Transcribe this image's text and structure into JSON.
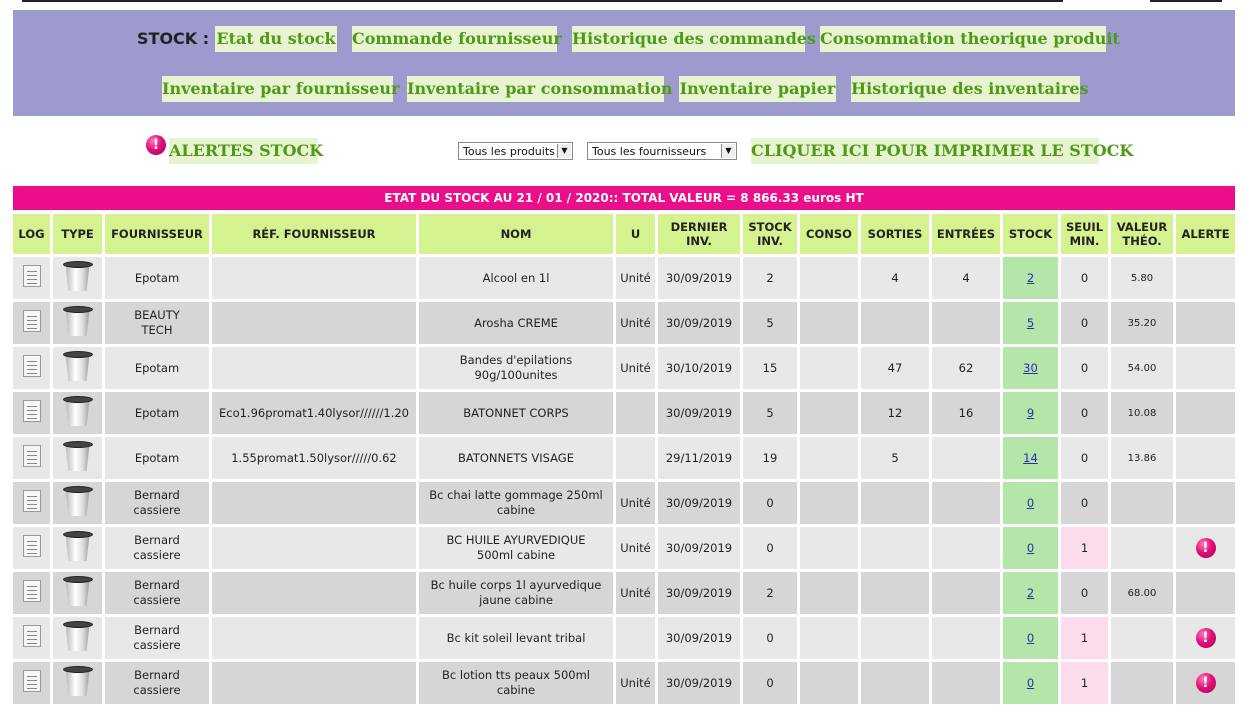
{
  "menu": {
    "stock_label": "STOCK :",
    "row1": [
      "Etat du stock",
      "Commande fournisseur",
      "Historique des commandes",
      "Consommation theorique produit"
    ],
    "row2": [
      "Inventaire par fournisseur",
      "Inventaire par consommation",
      "Inventaire papier",
      "Historique des inventaires"
    ]
  },
  "alerts": {
    "alert_icon_glyph": "!",
    "alertes_label": "ALERTES STOCK",
    "product_select": "Tous les produits",
    "supplier_select": "Tous les fournisseurs",
    "select_arrow": "▼",
    "print_label": "CLIQUER ICI POUR IMPRIMER LE STOCK"
  },
  "title_bar": "ETAT DU STOCK AU 21 / 01 / 2020:: TOTAL VALEUR = 8 866.33 euros HT",
  "table": {
    "headers": {
      "log": "LOG",
      "type": "TYPE",
      "fournisseur": "FOURNISSEUR",
      "ref": "RÉF. FOURNISSEUR",
      "nom": "NOM",
      "u": "U",
      "dernier_1": "DERNIER",
      "dernier_2": "INV.",
      "stockinv_1": "STOCK",
      "stockinv_2": "INV.",
      "conso": "CONSO",
      "sorties": "SORTIES",
      "entrees": "ENTRÉES",
      "stock": "STOCK",
      "seuil_1": "SEUIL",
      "seuil_2": "MIN.",
      "valeur_1": "VALEUR",
      "valeur_2": "THÉO.",
      "alerte": "ALERTE"
    },
    "alert_glyph": "!",
    "rows": [
      {
        "fournisseur": "Epotam",
        "ref": "",
        "nom": "Alcool en 1l",
        "u": "Unité",
        "dernier": "30/09/2019",
        "stockinv": "2",
        "conso": "",
        "sorties": "4",
        "entrees": "4",
        "stock": "2",
        "seuil": "0",
        "valeur": "5.80",
        "alerte": false
      },
      {
        "fournisseur": "BEAUTY TECH",
        "ref": "",
        "nom": "Arosha CREME",
        "u": "Unité",
        "dernier": "30/09/2019",
        "stockinv": "5",
        "conso": "",
        "sorties": "",
        "entrees": "",
        "stock": "5",
        "seuil": "0",
        "valeur": "35.20",
        "alerte": false
      },
      {
        "fournisseur": "Epotam",
        "ref": "",
        "nom": "Bandes d'epilations 90g/100unites",
        "u": "Unité",
        "dernier": "30/10/2019",
        "stockinv": "15",
        "conso": "",
        "sorties": "47",
        "entrees": "62",
        "stock": "30",
        "seuil": "0",
        "valeur": "54.00",
        "alerte": false
      },
      {
        "fournisseur": "Epotam",
        "ref": "Eco1.96promat1.40lysor//////1.20",
        "nom": "BATONNET CORPS",
        "u": "",
        "dernier": "30/09/2019",
        "stockinv": "5",
        "conso": "",
        "sorties": "12",
        "entrees": "16",
        "stock": "9",
        "seuil": "0",
        "valeur": "10.08",
        "alerte": false
      },
      {
        "fournisseur": "Epotam",
        "ref": "1.55promat1.50lysor/////0.62",
        "nom": "BATONNETS VISAGE",
        "u": "",
        "dernier": "29/11/2019",
        "stockinv": "19",
        "conso": "",
        "sorties": "5",
        "entrees": "",
        "stock": "14",
        "seuil": "0",
        "valeur": "13.86",
        "alerte": false
      },
      {
        "fournisseur": "Bernard cassiere",
        "ref": "",
        "nom": "Bc chai latte gommage 250ml cabine",
        "u": "Unité",
        "dernier": "30/09/2019",
        "stockinv": "0",
        "conso": "",
        "sorties": "",
        "entrees": "",
        "stock": "0",
        "seuil": "0",
        "valeur": "",
        "alerte": false
      },
      {
        "fournisseur": "Bernard cassiere",
        "ref": "",
        "nom": "BC HUILE AYURVEDIQUE 500ml cabine",
        "u": "Unité",
        "dernier": "30/09/2019",
        "stockinv": "0",
        "conso": "",
        "sorties": "",
        "entrees": "",
        "stock": "0",
        "seuil": "1",
        "valeur": "",
        "alerte": true
      },
      {
        "fournisseur": "Bernard cassiere",
        "ref": "",
        "nom": "Bc huile corps 1l ayurvedique jaune cabine",
        "u": "Unité",
        "dernier": "30/09/2019",
        "stockinv": "2",
        "conso": "",
        "sorties": "",
        "entrees": "",
        "stock": "2",
        "seuil": "0",
        "valeur": "68.00",
        "alerte": false
      },
      {
        "fournisseur": "Bernard cassiere",
        "ref": "",
        "nom": "Bc kit soleil levant tribal",
        "u": "",
        "dernier": "30/09/2019",
        "stockinv": "0",
        "conso": "",
        "sorties": "",
        "entrees": "",
        "stock": "0",
        "seuil": "1",
        "valeur": "",
        "alerte": true
      },
      {
        "fournisseur": "Bernard cassiere",
        "ref": "",
        "nom": "Bc lotion tts peaux 500ml cabine",
        "u": "Unité",
        "dernier": "30/09/2019",
        "stockinv": "0",
        "conso": "",
        "sorties": "",
        "entrees": "",
        "stock": "0",
        "seuil": "1",
        "valeur": "",
        "alerte": true
      }
    ]
  },
  "colors": {
    "menu_panel": "#9d9bce",
    "menu_button_bg": "#e8f3d2",
    "menu_button_text": "#4d9a15",
    "title_bar": "#ec0d8a",
    "header_bg": "#d4f28f",
    "stock_cell": "#b3e6a8",
    "seuil_alert": "#fcdcec"
  }
}
